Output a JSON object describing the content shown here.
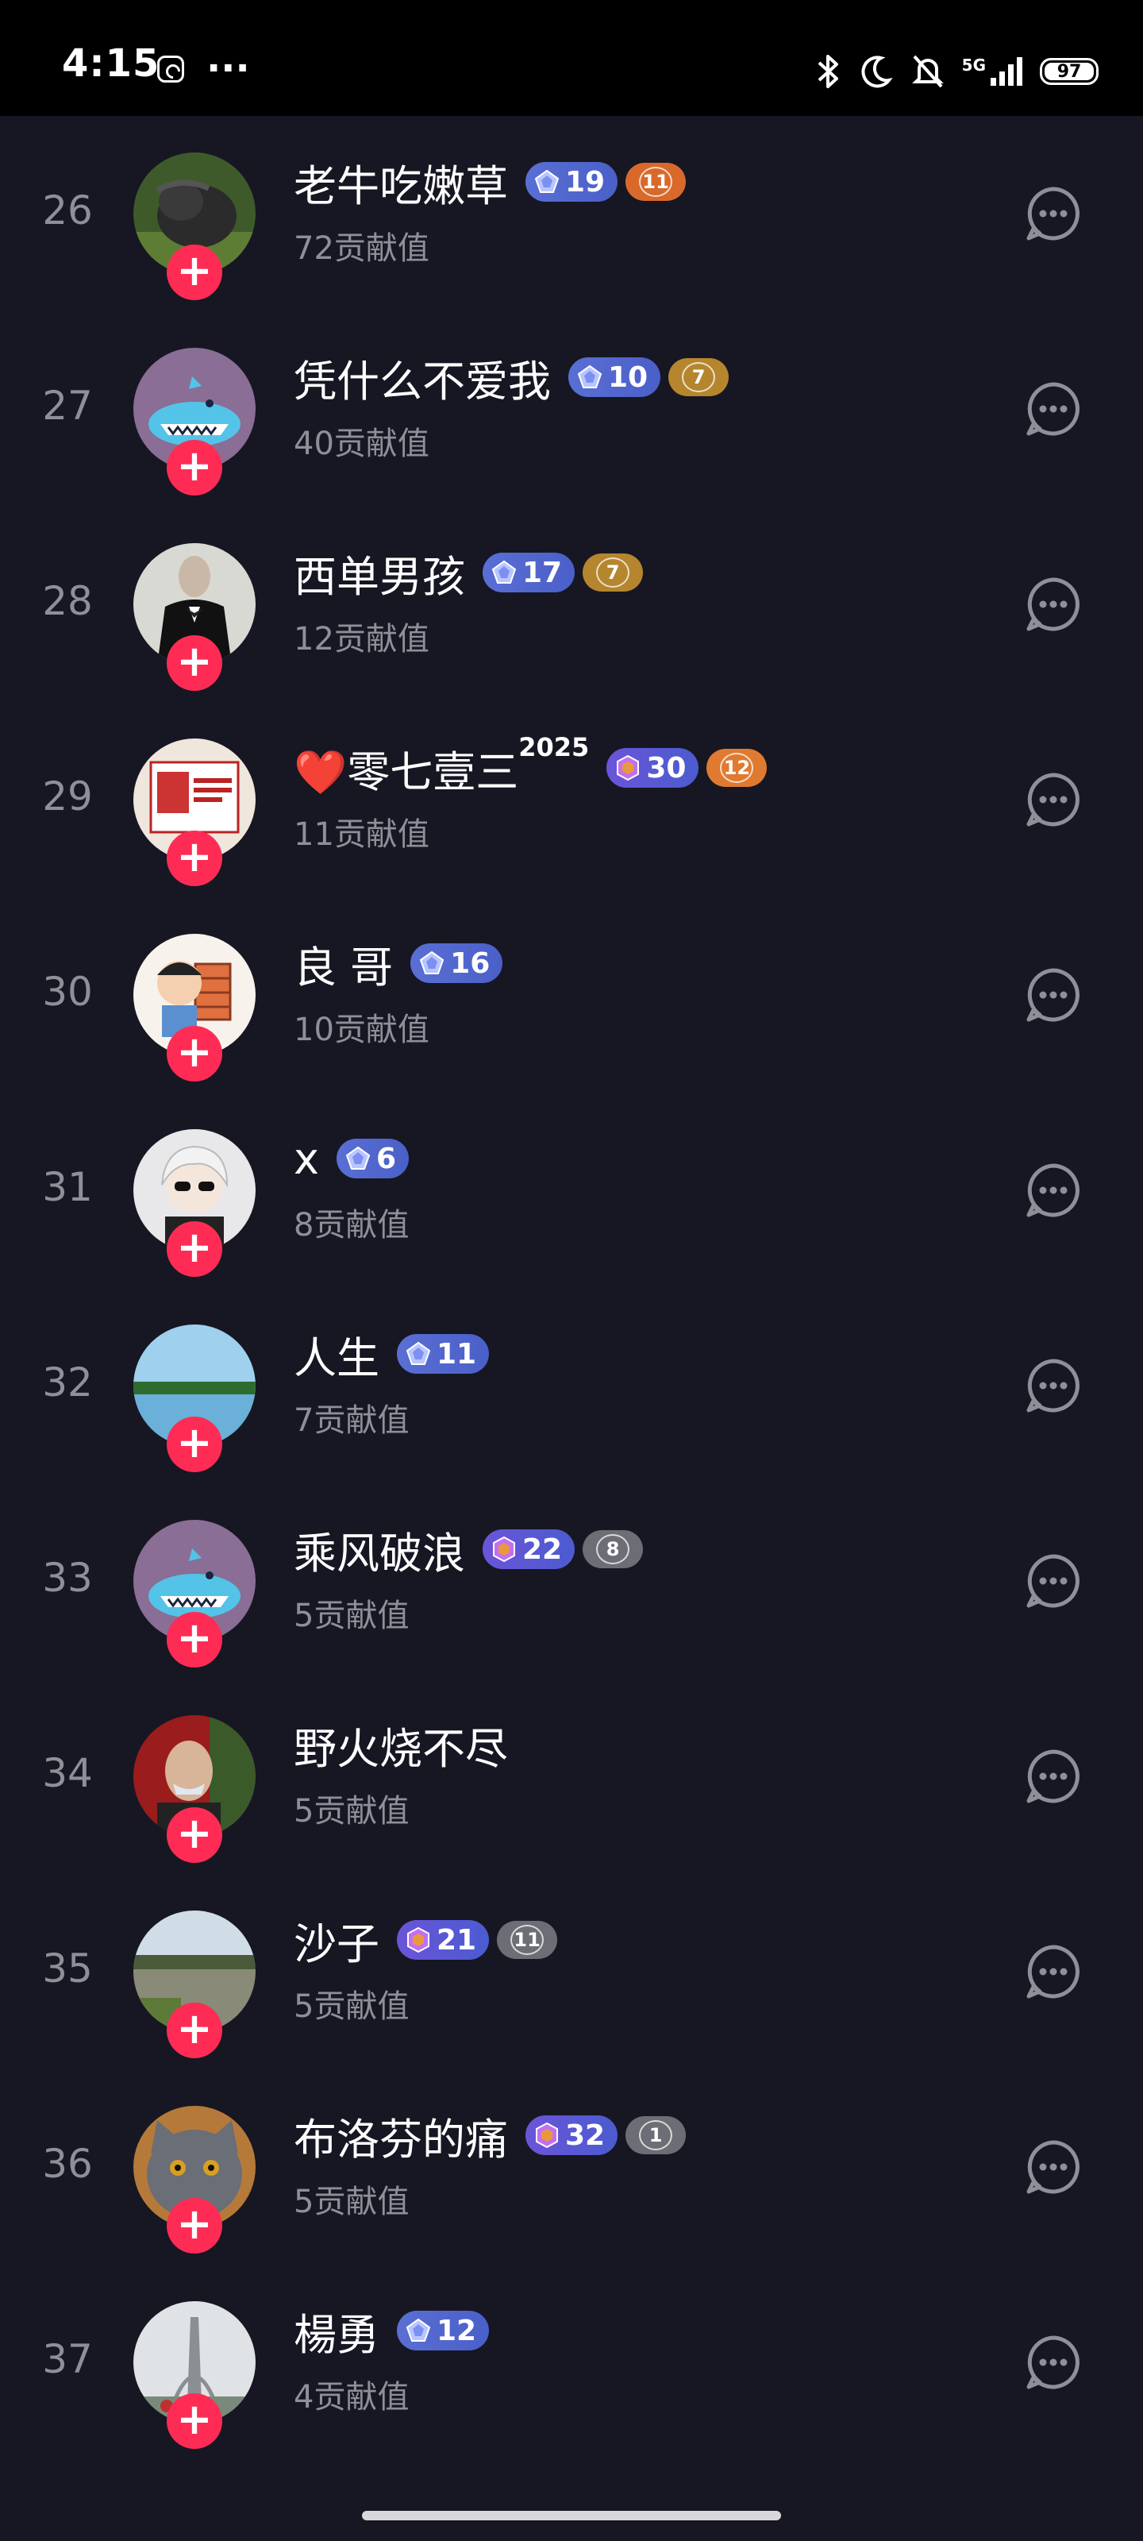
{
  "status_bar": {
    "time": "4:15",
    "more": "···",
    "network": "5G",
    "battery": "97"
  },
  "rows": [
    {
      "rank": "26",
      "name": "老牛吃嫩草",
      "sup": "",
      "level": "19",
      "fan": "11",
      "contrib": "72贡献值",
      "badge_style": "blue",
      "fan_color": "#d9692a",
      "avatar": "buffalo"
    },
    {
      "rank": "27",
      "name": "凭什么不爱我",
      "sup": "",
      "level": "10",
      "fan": "7",
      "contrib": "40贡献值",
      "badge_style": "blue",
      "fan_color": "#b5862e",
      "avatar": "default"
    },
    {
      "rank": "28",
      "name": "西单男孩",
      "sup": "",
      "level": "17",
      "fan": "7",
      "contrib": "12贡献值",
      "badge_style": "blue",
      "fan_color": "#b5862e",
      "avatar": "suit"
    },
    {
      "rank": "29",
      "name": "❤️零七壹三",
      "sup": "2025",
      "level": "30",
      "fan": "12",
      "contrib": "11贡献值",
      "badge_style": "purple",
      "fan_color": "#e07a30",
      "avatar": "poster"
    },
    {
      "rank": "30",
      "name": "良 哥",
      "sup": "",
      "level": "16",
      "fan": "",
      "contrib": "10贡献值",
      "badge_style": "blue",
      "fan_color": "",
      "avatar": "cartoon"
    },
    {
      "rank": "31",
      "name": "x",
      "sup": "",
      "level": "6",
      "fan": "",
      "contrib": "8贡献值",
      "badge_style": "blue",
      "fan_color": "",
      "avatar": "anime"
    },
    {
      "rank": "32",
      "name": "人生",
      "sup": "",
      "level": "11",
      "fan": "",
      "contrib": "7贡献值",
      "badge_style": "blue",
      "fan_color": "",
      "avatar": "lake"
    },
    {
      "rank": "33",
      "name": "乘风破浪",
      "sup": "",
      "level": "22",
      "fan": "8",
      "contrib": "5贡献值",
      "badge_style": "purple",
      "fan_color": "#6d6e75",
      "avatar": "default"
    },
    {
      "rank": "34",
      "name": "野火烧不尽",
      "sup": "",
      "level": "",
      "fan": "",
      "contrib": "5贡献值",
      "badge_style": "blue",
      "fan_color": "",
      "avatar": "man"
    },
    {
      "rank": "35",
      "name": "沙子",
      "sup": "",
      "level": "21",
      "fan": "11",
      "contrib": "5贡献值",
      "badge_style": "purple",
      "fan_color": "#6d6e75",
      "avatar": "park"
    },
    {
      "rank": "36",
      "name": "布洛芬的痛",
      "sup": "",
      "level": "32",
      "fan": "1",
      "contrib": "5贡献值",
      "badge_style": "purple",
      "fan_color": "#6d6e75",
      "avatar": "cat"
    },
    {
      "rank": "37",
      "name": "楊勇",
      "sup": "",
      "level": "12",
      "fan": "",
      "contrib": "4贡献值",
      "badge_style": "blue",
      "fan_color": "",
      "avatar": "tower"
    }
  ],
  "follow_symbol": "+"
}
